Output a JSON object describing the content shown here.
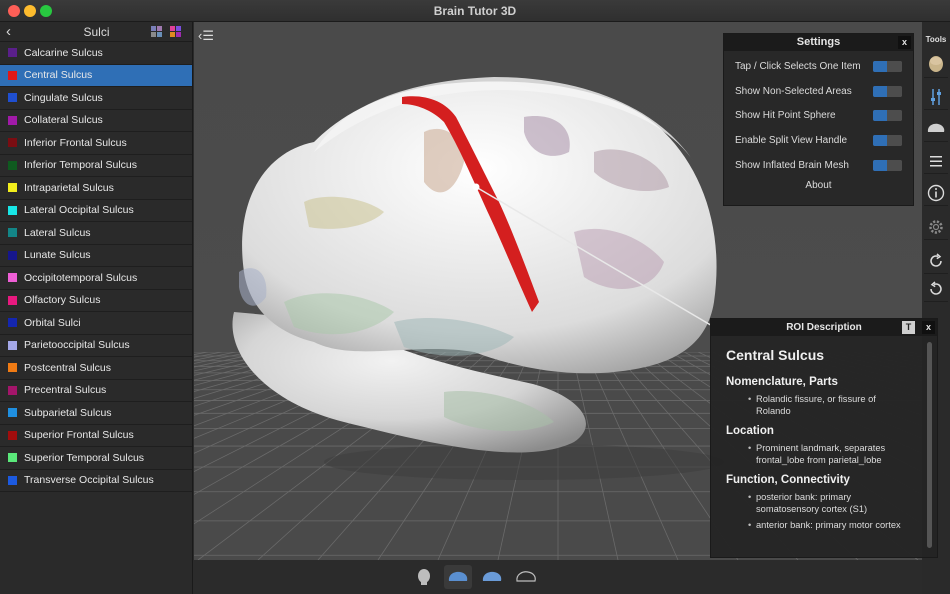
{
  "window": {
    "title": "Brain Tutor 3D"
  },
  "sidebar": {
    "title": "Sulci",
    "items": [
      {
        "label": "Calcarine Sulcus",
        "color": "#5a1f8a"
      },
      {
        "label": "Central Sulcus",
        "color": "#e01818",
        "active": true
      },
      {
        "label": "Cingulate Sulcus",
        "color": "#1f4fd0"
      },
      {
        "label": "Collateral Sulcus",
        "color": "#a11aa8"
      },
      {
        "label": "Inferior Frontal Sulcus",
        "color": "#7a0d12"
      },
      {
        "label": "Inferior Temporal Sulcus",
        "color": "#0f5a1f"
      },
      {
        "label": "Intraparietal Sulcus",
        "color": "#f2ee1c"
      },
      {
        "label": "Lateral Occipital Sulcus",
        "color": "#18e6e6"
      },
      {
        "label": "Lateral Sulcus",
        "color": "#138587"
      },
      {
        "label": "Lunate Sulcus",
        "color": "#16168c"
      },
      {
        "label": "Occipitotemporal Sulcus",
        "color": "#ef5fd6"
      },
      {
        "label": "Olfactory Sulcus",
        "color": "#e8197f"
      },
      {
        "label": "Orbital Sulci",
        "color": "#1426b0"
      },
      {
        "label": "Parietooccipital Sulcus",
        "color": "#a4a8e8"
      },
      {
        "label": "Postcentral Sulcus",
        "color": "#f07b14"
      },
      {
        "label": "Precentral Sulcus",
        "color": "#a3156a"
      },
      {
        "label": "Subparietal Sulcus",
        "color": "#1f8fe0"
      },
      {
        "label": "Superior Frontal Sulcus",
        "color": "#a10d0d"
      },
      {
        "label": "Superior Temporal Sulcus",
        "color": "#5ae87a"
      },
      {
        "label": "Transverse Occipital Sulcus",
        "color": "#1c5ae0"
      }
    ]
  },
  "tools": {
    "title": "Tools"
  },
  "settings": {
    "title": "Settings",
    "close": "x",
    "rows": [
      {
        "label": "Tap / Click Selects One Item",
        "on": true
      },
      {
        "label": "Show Non-Selected Areas",
        "on": true
      },
      {
        "label": "Show Hit Point Sphere",
        "on": true
      },
      {
        "label": "Enable Split View Handle",
        "on": true
      },
      {
        "label": "Show Inflated Brain Mesh",
        "on": true
      }
    ],
    "about": "About"
  },
  "roi": {
    "header": "ROI Description",
    "t_label": "T",
    "close": "x",
    "title": "Central Sulcus",
    "sections": [
      {
        "heading": "Nomenclature, Parts",
        "items": [
          "Rolandic fissure, or fissure of Rolando"
        ]
      },
      {
        "heading": "Location",
        "items": [
          "Prominent landmark, separates frontal_lobe from parietal_lobe"
        ]
      },
      {
        "heading": "Function, Connectivity",
        "items": [
          "posterior bank: primary somatosensory cortex (S1)",
          "anterior bank: primary motor cortex"
        ]
      }
    ]
  },
  "colors": {
    "accent": "#2f6fb6",
    "selected_region": "#e01818"
  }
}
